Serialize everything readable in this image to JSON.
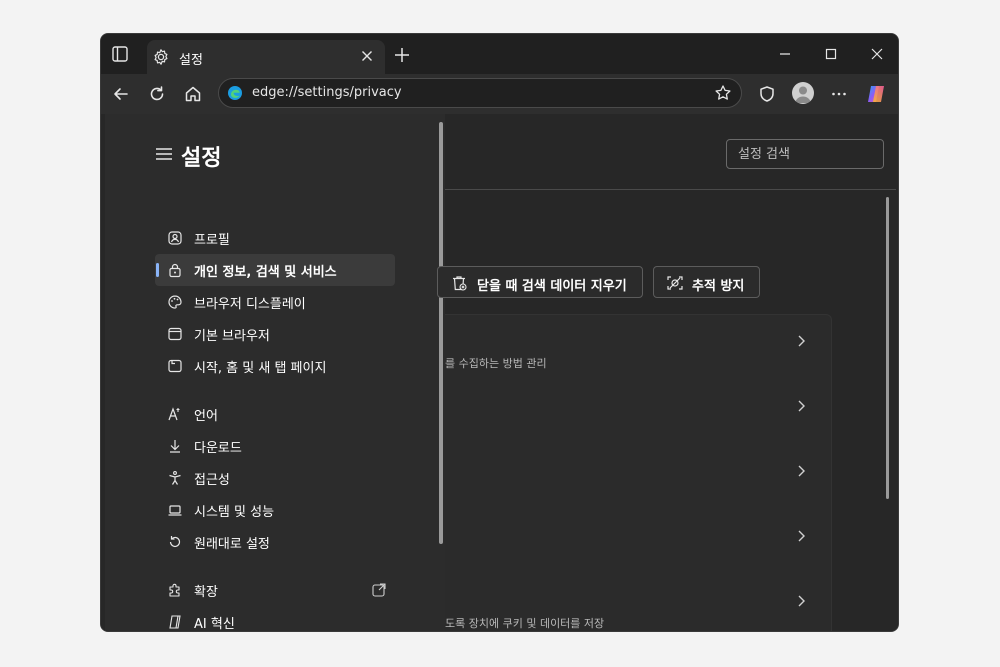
{
  "tab": {
    "title": "설정"
  },
  "address": {
    "url": "edge://settings/privacy"
  },
  "sidebar": {
    "title": "설정",
    "items": [
      {
        "label": "프로필",
        "icon": "profile-icon"
      },
      {
        "label": "개인 정보, 검색 및 서비스",
        "icon": "lock-icon",
        "selected": true
      },
      {
        "label": "브라우저 디스플레이",
        "icon": "palette-icon"
      },
      {
        "label": "기본 브라우저",
        "icon": "browser-window-icon"
      },
      {
        "label": "시작, 홈 및 새 탭 페이지",
        "icon": "new-tab-page-icon"
      },
      {
        "label": "언어",
        "icon": "language-icon"
      },
      {
        "label": "다운로드",
        "icon": "download-icon"
      },
      {
        "label": "접근성",
        "icon": "accessibility-icon"
      },
      {
        "label": "시스템 및 성능",
        "icon": "laptop-icon"
      },
      {
        "label": "원래대로 설정",
        "icon": "reset-icon"
      },
      {
        "label": "확장",
        "icon": "extension-icon"
      },
      {
        "label": "AI 혁신",
        "icon": "ai-icon"
      }
    ]
  },
  "search": {
    "placeholder": "설정 검색"
  },
  "main": {
    "buttons": {
      "clear_on_close": "닫을 때 검색 데이터 지우기",
      "tracking_prevention": "추적 방지"
    },
    "partial_text_1": "를 수집하는 방법 관리",
    "partial_text_2": "도록 장치에 쿠키 및 데이터를 저장"
  },
  "colors": {
    "accent": "#8ab4f8",
    "background": "#272727",
    "panel": "#2c2c2c"
  }
}
